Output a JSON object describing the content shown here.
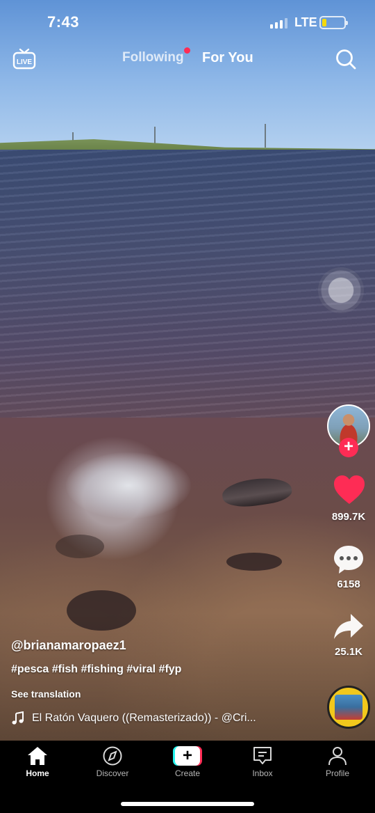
{
  "status_bar": {
    "time": "7:43",
    "network": "LTE",
    "battery_percent": 20,
    "battery_color": "#f5d90a"
  },
  "top_nav": {
    "live_label": "LIVE",
    "following_label": "Following",
    "following_has_new": true,
    "for_you_label": "For You",
    "selected_tab": "For You"
  },
  "actions": {
    "like_count": "899.7K",
    "like_color": "#fe2c55",
    "comment_count": "6158",
    "share_count": "25.1K",
    "follow_plus": "+"
  },
  "caption": {
    "username": "@brianamaropaez1",
    "hashtags": "#pesca #fish #fishing #viral #fyp",
    "see_translation": "See translation",
    "sound": "El Ratón Vaquero ((Remasterizado)) - @Cri..."
  },
  "tabbar": {
    "items": [
      {
        "label": "Home",
        "icon": "home-icon",
        "active": true
      },
      {
        "label": "Discover",
        "icon": "compass-icon",
        "active": false
      },
      {
        "label": "Create",
        "icon": "create-plus-icon",
        "active": false
      },
      {
        "label": "Inbox",
        "icon": "inbox-icon",
        "active": false
      },
      {
        "label": "Profile",
        "icon": "person-icon",
        "active": false
      }
    ],
    "create_symbol": "+"
  },
  "colors": {
    "accent": "#fe2c55",
    "cyan": "#25f4ee"
  }
}
